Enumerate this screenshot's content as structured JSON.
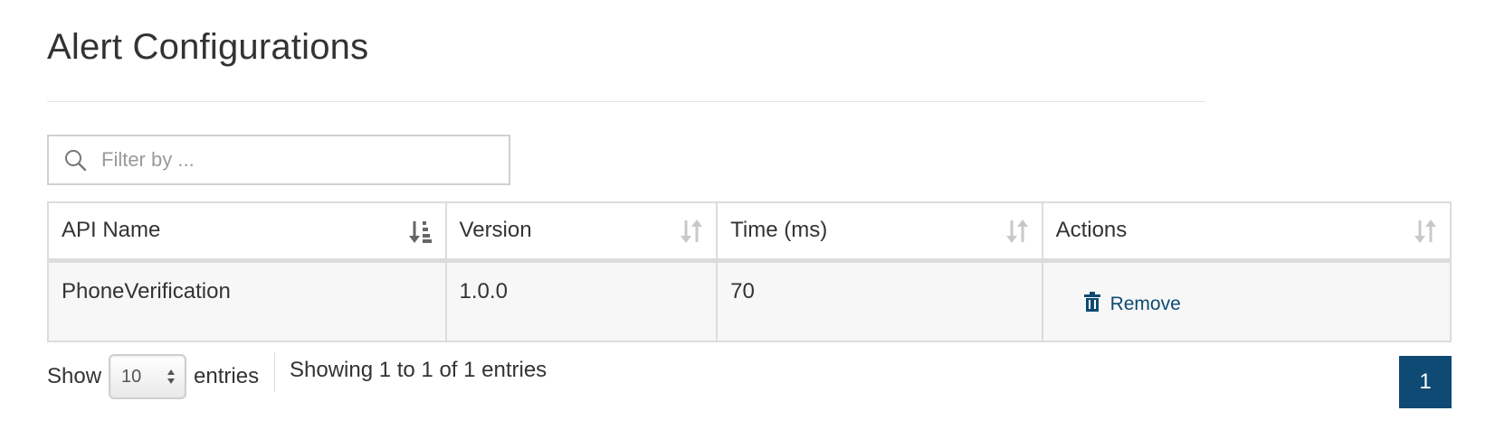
{
  "page": {
    "title": "Alert Configurations"
  },
  "filter": {
    "placeholder": "Filter by ...",
    "value": ""
  },
  "table": {
    "columns": [
      {
        "label": "API Name",
        "sort": "ascending"
      },
      {
        "label": "Version",
        "sort": "none"
      },
      {
        "label": "Time (ms)",
        "sort": "none"
      },
      {
        "label": "Actions",
        "sort": "none"
      }
    ],
    "rows": [
      {
        "api_name": "PhoneVerification",
        "version": "1.0.0",
        "time_ms": "70",
        "action_label": "Remove"
      }
    ]
  },
  "footer": {
    "show_label": "Show",
    "page_size": "10",
    "entries_label": "entries",
    "info": "Showing 1 to 1 of 1 entries",
    "current_page": "1"
  },
  "icons": {
    "filter": "search-icon",
    "sort_active": "sort-alpha-ascending-icon",
    "sort_inactive": "sort-both-icon",
    "remove": "trash-icon"
  },
  "colors": {
    "accent": "#0e4a73",
    "border": "#dcdcdc",
    "row_background": "#f7f7f7"
  }
}
